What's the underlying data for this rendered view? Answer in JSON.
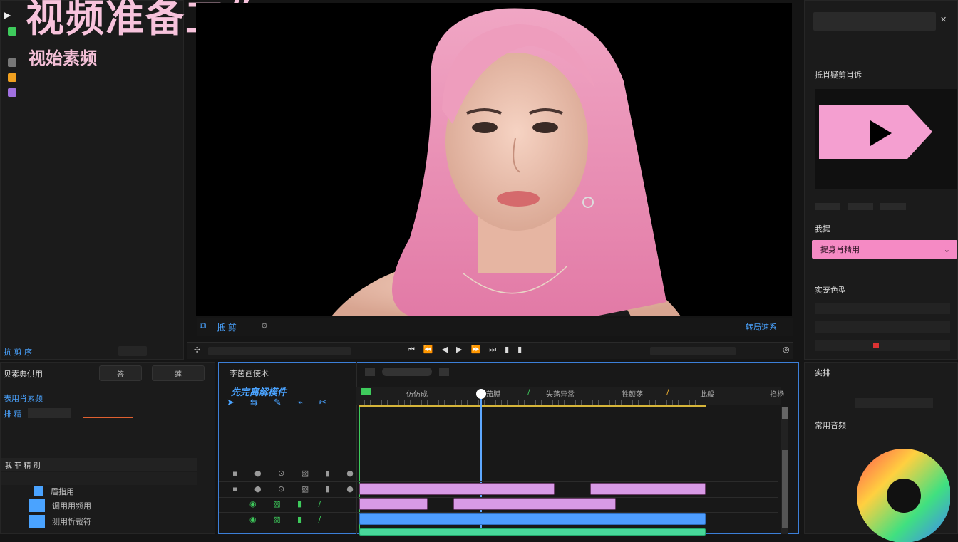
{
  "overlay": {
    "title": "视频准备工作",
    "subtitle": "视始素频"
  },
  "left_panel": {
    "rows": [
      {
        "label": "",
        "color": "#3ecb5c"
      },
      {
        "label": "",
        "color": "#777777"
      },
      {
        "label": "",
        "color": "#f0a020"
      },
      {
        "label": "",
        "color": "#a070e0"
      }
    ],
    "bottom_label": "抗 剪 序"
  },
  "viewer": {
    "mode_label": "抵 剪",
    "right_label": "转局速系"
  },
  "right_panel": {
    "section_title": "抵肖疑剪肖诉",
    "effects_label": "我提",
    "effect_selected": "提身肖精用",
    "adjust_title": "实茏色型",
    "color_title": "常用音频",
    "hue_label": "实排"
  },
  "effects_panel": {
    "title": "贝素典供用",
    "tab_a": "答",
    "tab_b": "莲",
    "item": "表用肖素频",
    "field_label": "排 精",
    "list_title": "我 菲 精 刷",
    "list_items": [
      "眉指用",
      "调用用频用",
      "测用忻裁符"
    ]
  },
  "timeline": {
    "title": "李茵画使术",
    "sub_title": "先完离解模件",
    "markers": [
      "仿仿成",
      "茄膊",
      "失荡异常",
      "牲颜荡",
      "此般",
      "掐杨"
    ],
    "video_clip_labels": [
      "",
      "",
      "",
      ""
    ]
  },
  "colors": {
    "accent_pink": "#f58ac4",
    "accent_blue": "#4aa3ff",
    "accent_green": "#3ecb5c",
    "overlay_pink": "#f7c3dc"
  }
}
